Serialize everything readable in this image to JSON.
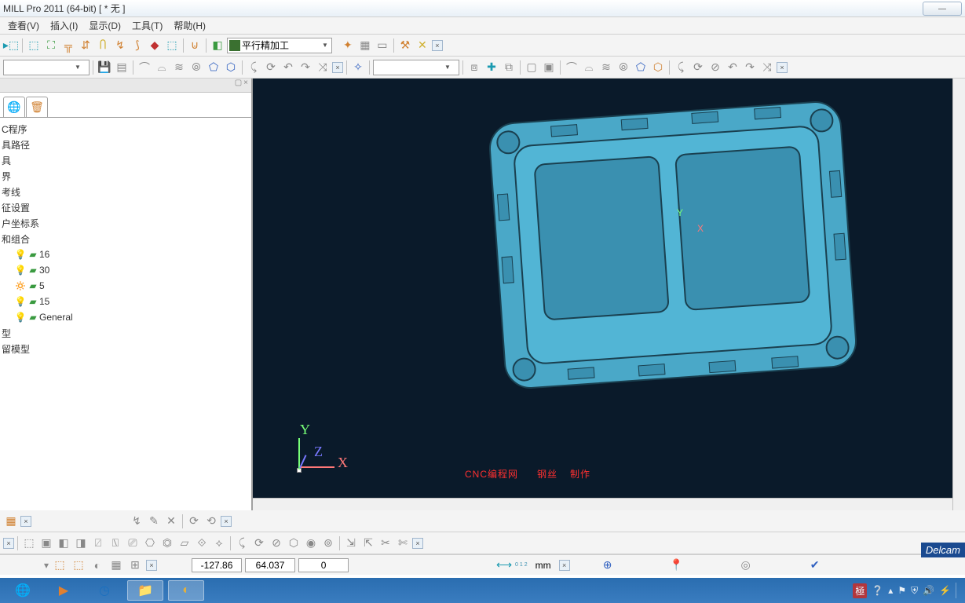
{
  "title": "MILL Pro 2011 (64-bit)      [ * 无 ]",
  "menu": [
    "查看(V)",
    "插入(I)",
    "显示(D)",
    "工具(T)",
    "帮助(H)"
  ],
  "combo_strategy": "平行精加工",
  "tree": {
    "items": [
      {
        "label": "C程序",
        "icon": ""
      },
      {
        "label": "具路径",
        "icon": ""
      },
      {
        "label": "具",
        "icon": ""
      },
      {
        "label": "界",
        "icon": ""
      },
      {
        "label": "考线",
        "icon": ""
      },
      {
        "label": "征设置",
        "icon": ""
      },
      {
        "label": "户坐标系",
        "icon": ""
      },
      {
        "label": "和组合",
        "icon": ""
      }
    ],
    "levels": [
      {
        "label": "16",
        "on": true
      },
      {
        "label": "30",
        "on": true
      },
      {
        "label": "5",
        "on": false
      },
      {
        "label": "15",
        "on": true
      },
      {
        "label": "General",
        "on": true
      }
    ],
    "bottom": [
      "型",
      "留模型",
      ""
    ]
  },
  "watermark_parts": [
    "CNC编程网",
    "钢丝",
    "制作"
  ],
  "axis": {
    "y": "Y",
    "x": "X",
    "z": "Z"
  },
  "status": {
    "coords": [
      "-127.86",
      "64.037",
      "0"
    ],
    "unit": "mm",
    "scale_label": "0 1 2"
  },
  "badge": "Delcam",
  "tray": {
    "ime": "極"
  }
}
